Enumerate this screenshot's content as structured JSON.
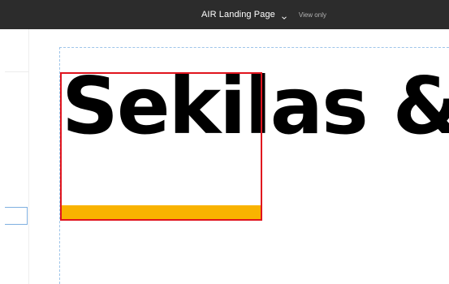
{
  "header": {
    "file_title": "AIR Landing Page",
    "menu_icon": "chevron-down-icon",
    "mode_label": "View only"
  },
  "canvas": {
    "heading_text": "Sekilas &",
    "accent_color": "#f9b300",
    "selection_color": "#e0141e"
  }
}
